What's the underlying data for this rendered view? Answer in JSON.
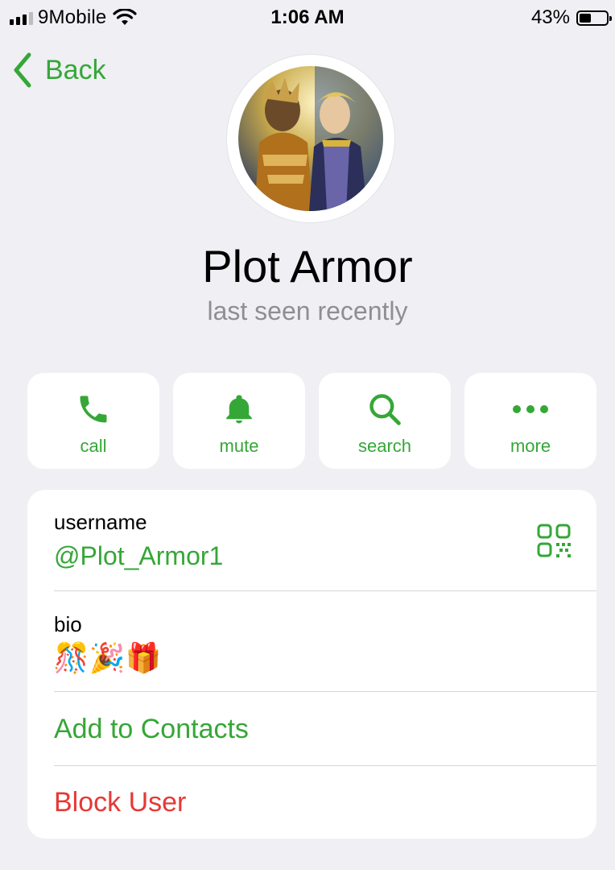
{
  "status_bar": {
    "carrier": "9Mobile",
    "time": "1:06 AM",
    "battery_percent": "43%",
    "battery_level": 0.43
  },
  "nav": {
    "back_label": "Back"
  },
  "profile": {
    "name": "Plot Armor",
    "status": "last seen recently"
  },
  "actions": [
    {
      "label": "call",
      "icon": "phone-icon"
    },
    {
      "label": "mute",
      "icon": "bell-icon"
    },
    {
      "label": "search",
      "icon": "search-icon"
    },
    {
      "label": "more",
      "icon": "more-dots-icon"
    }
  ],
  "info": {
    "username_label": "username",
    "username_value": "@Plot_Armor1",
    "bio_label": "bio",
    "bio_value": "🎊🎉🎁",
    "add_contacts_label": "Add to Contacts",
    "block_user_label": "Block User"
  },
  "colors": {
    "accent": "#35a737",
    "destructive": "#e53935",
    "background": "#efeff4",
    "secondary_text": "#8e8e93"
  }
}
